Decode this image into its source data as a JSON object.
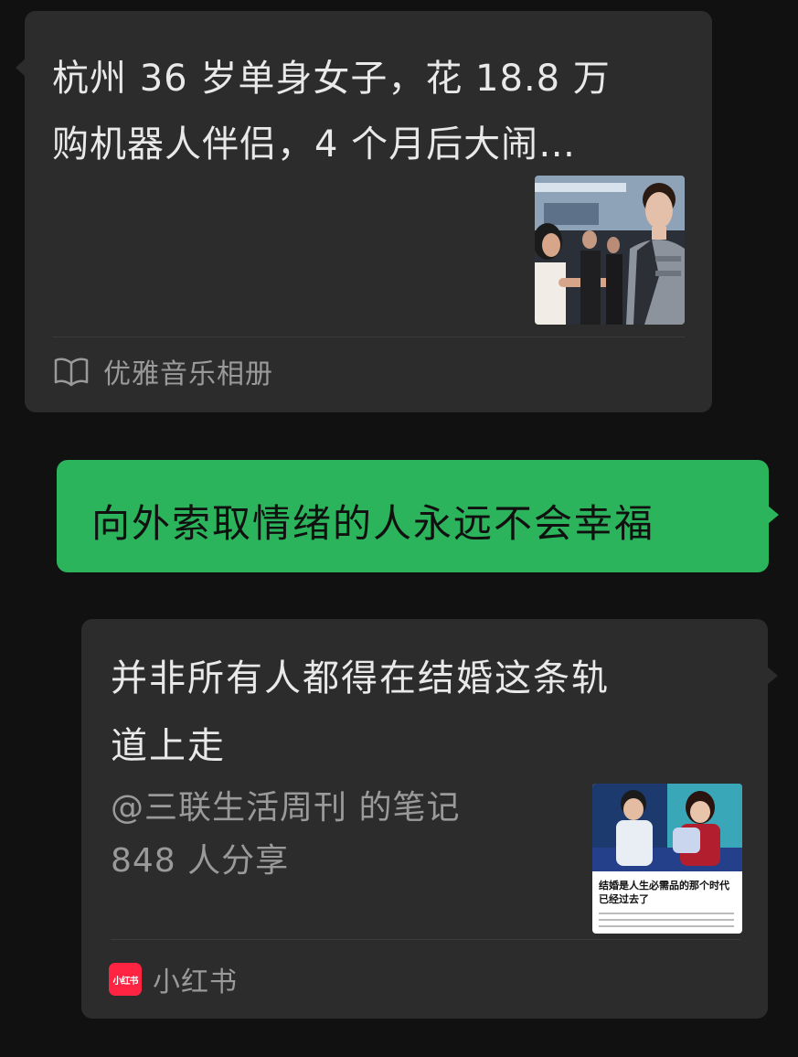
{
  "messages": [
    {
      "type": "link-card",
      "title_line1": "杭州 36 岁单身女子，花 18.8 万",
      "title_line2": "购机器人伴侣，4 个月后大闹…",
      "thumbnail_icon": "robot-photo",
      "source_icon": "open-book-icon",
      "source": "优雅音乐相册"
    },
    {
      "type": "text",
      "text": "向外索取情绪的人永远不会幸福"
    },
    {
      "type": "note-card",
      "title_line1": "并非所有人都得在结婚这条轨",
      "title_line2": "道上走",
      "author_note": "@三联生活周刊 的笔记",
      "shares": "848 人分享",
      "thumbnail": {
        "headline_line1": "结婚是人生必需品的那个时代",
        "headline_line2": "已经过去了"
      },
      "source_logo": "小红书",
      "source": "小红书"
    }
  ],
  "colors": {
    "background": "#111111",
    "incoming_bubble": "#2c2c2c",
    "outgoing_bubble": "#2bb45b",
    "brand_red": "#ff2442"
  }
}
